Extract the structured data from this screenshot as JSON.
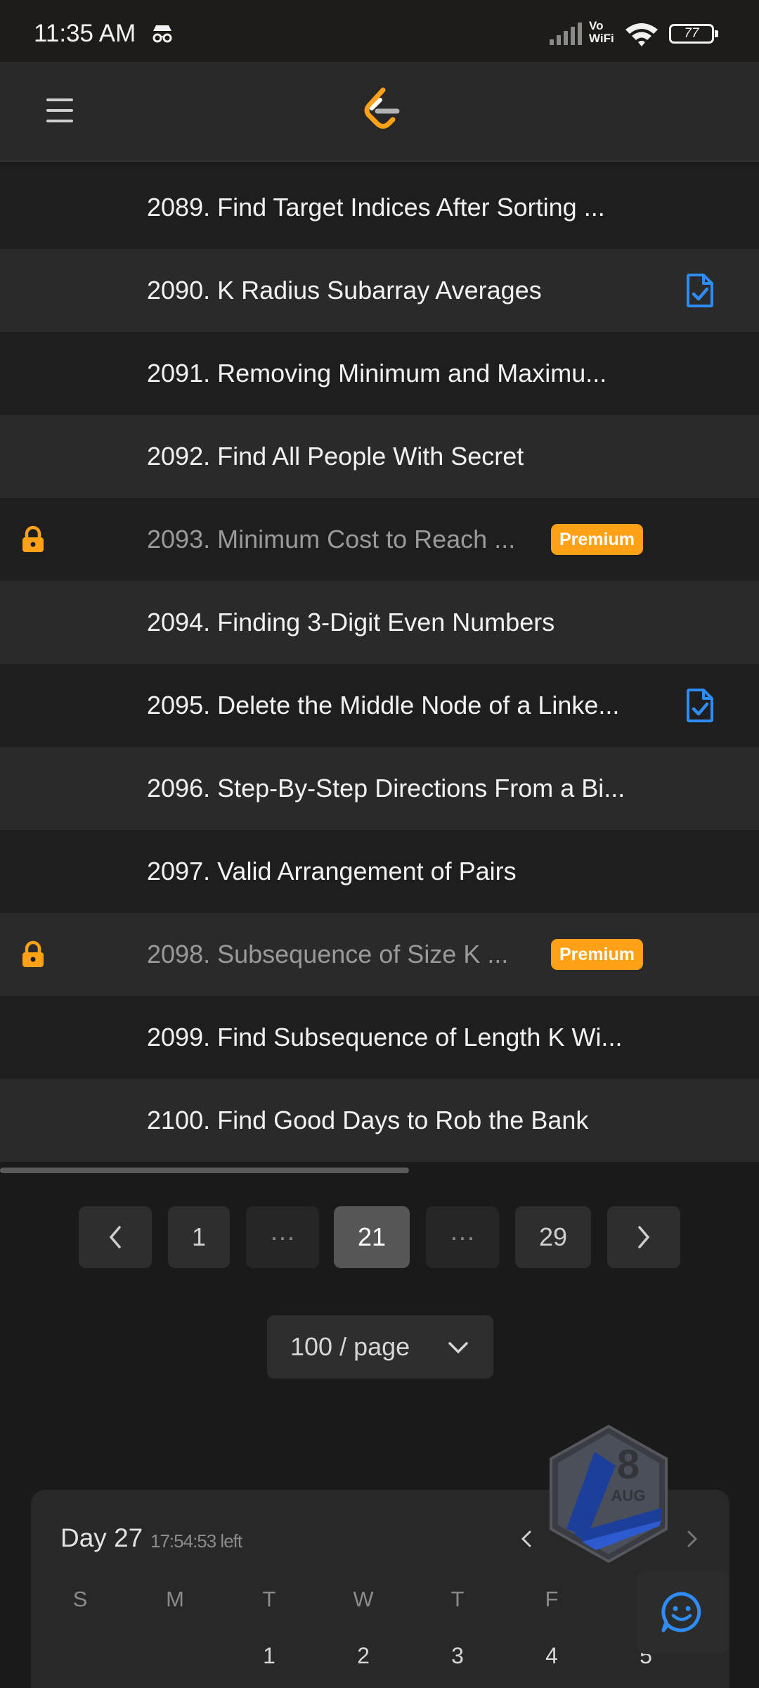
{
  "status_bar": {
    "time": "11:35 AM",
    "vo_line1": "Vo",
    "vo_line2": "WiFi",
    "battery": "77",
    "icons": [
      "incognito-icon",
      "signal-icon",
      "vowifi-icon",
      "wifi-icon",
      "battery-icon"
    ]
  },
  "header": {
    "menu_icon": "hamburger-menu-icon",
    "logo": "leetcode-logo"
  },
  "problems": [
    {
      "title": "2089. Find Target Indices After Sorting ...",
      "locked": false,
      "premium": false,
      "solved": false
    },
    {
      "title": "2090. K Radius Subarray Averages",
      "locked": false,
      "premium": false,
      "solved": true
    },
    {
      "title": "2091. Removing Minimum and Maximu...",
      "locked": false,
      "premium": false,
      "solved": false
    },
    {
      "title": "2092. Find All People With Secret",
      "locked": false,
      "premium": false,
      "solved": false
    },
    {
      "title": "2093. Minimum Cost to Reach ...",
      "locked": true,
      "premium": true,
      "solved": false
    },
    {
      "title": "2094. Finding 3-Digit Even Numbers",
      "locked": false,
      "premium": false,
      "solved": false
    },
    {
      "title": "2095. Delete the Middle Node of a Linke...",
      "locked": false,
      "premium": false,
      "solved": true
    },
    {
      "title": "2096. Step-By-Step Directions From a Bi...",
      "locked": false,
      "premium": false,
      "solved": false
    },
    {
      "title": "2097. Valid Arrangement of Pairs",
      "locked": false,
      "premium": false,
      "solved": false
    },
    {
      "title": "2098. Subsequence of Size K ...",
      "locked": true,
      "premium": true,
      "solved": false
    },
    {
      "title": "2099. Find Subsequence of Length K Wi...",
      "locked": false,
      "premium": false,
      "solved": false
    },
    {
      "title": "2100. Find Good Days to Rob the Bank",
      "locked": false,
      "premium": false,
      "solved": false
    }
  ],
  "premium_label": "Premium",
  "pagination": {
    "first": "1",
    "dots": "···",
    "current": "21",
    "last": "29",
    "prev_icon": "chevron-left-icon",
    "next_icon": "chevron-right-icon"
  },
  "page_size": {
    "label": "100 / page",
    "icon": "chevron-down-icon"
  },
  "calendar": {
    "day": "Day 27",
    "time_left": "17:54:53 left",
    "weekdays": [
      "S",
      "M",
      "T",
      "W",
      "T",
      "F",
      "S"
    ],
    "dates": [
      "1",
      "2",
      "3",
      "4",
      "5"
    ],
    "badge_day": "8",
    "badge_month": "AUG"
  },
  "colors": {
    "accent": "#ffa116",
    "solved_blue": "#2f8cf5",
    "background": "#1a1a1a",
    "row_alt": "#2a2a2a"
  }
}
